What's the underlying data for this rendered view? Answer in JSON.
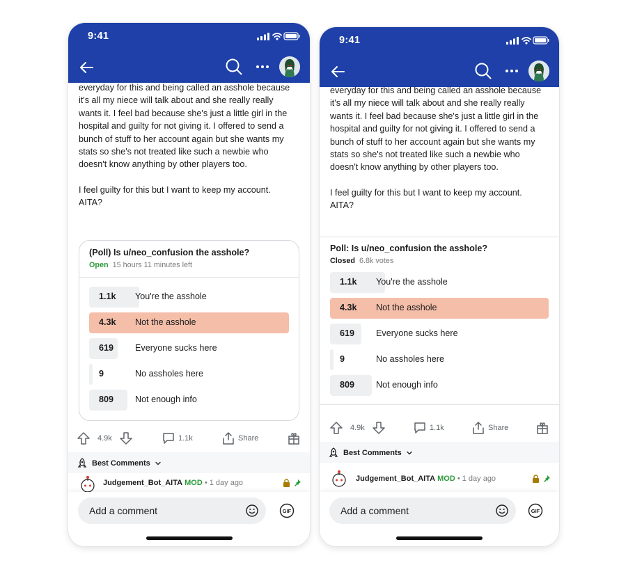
{
  "colors": {
    "header": "#1e40a8",
    "open": "#2d9b3c",
    "mod": "#2d9b3c",
    "winner_fill": "#f4bea9",
    "bar_fill": "#edeff1",
    "pin": "#2d9b3c",
    "lock": "#a67c00"
  },
  "post_body": {
    "paragraph1": "everyday for this and being called an asshole because it's all my niece will talk about and she really really wants it. I feel bad because she's just a little girl in the hospital and guilty for not giving it. I offered to send a bunch of stuff to her account again but she wants my stats so she's not treated like such a newbie who doesn't know anything by other players too.",
    "paragraph2": "I feel guilty for this but I want to keep my account. AITA?"
  },
  "left": {
    "time": "9:41",
    "poll": {
      "title": "(Poll) Is u/neo_confusion the asshole?",
      "state": "Open",
      "detail": "15 hours 11 minutes left",
      "options": [
        {
          "count": "1.1k",
          "label": "You're the asshole",
          "fraction": 0.25,
          "winner": false
        },
        {
          "count": "4.3k",
          "label": "Not the asshole",
          "fraction": 1.0,
          "winner": true
        },
        {
          "count": "619",
          "label": "Everyone sucks here",
          "fraction": 0.144,
          "winner": false
        },
        {
          "count": "9",
          "label": "No assholes here",
          "fraction": 0.01,
          "winner": false
        },
        {
          "count": "809",
          "label": "Not enough info",
          "fraction": 0.19,
          "winner": false
        }
      ]
    },
    "votes": "4.9k",
    "comments": "1.1k",
    "share": "Share",
    "sort": "Best Comments",
    "comment": {
      "author": "Judgement_Bot_AITA",
      "mod": "MOD",
      "age": "• 1 day ago"
    },
    "composer": {
      "placeholder": "Add a comment",
      "gif": "GIF"
    }
  },
  "right": {
    "time": "9:41",
    "poll": {
      "title": "Poll: Is u/neo_confusion the asshole?",
      "state": "Closed",
      "detail": "6.8k votes",
      "options": [
        {
          "count": "1.1k",
          "label": "You're the asshole",
          "fraction": 0.25,
          "winner": false
        },
        {
          "count": "4.3k",
          "label": "Not the asshole",
          "fraction": 1.0,
          "winner": true
        },
        {
          "count": "619",
          "label": "Everyone sucks here",
          "fraction": 0.144,
          "winner": false
        },
        {
          "count": "9",
          "label": "No assholes here",
          "fraction": 0.01,
          "winner": false
        },
        {
          "count": "809",
          "label": "Not enough info",
          "fraction": 0.19,
          "winner": false
        }
      ]
    },
    "votes": "4.9k",
    "comments": "1.1k",
    "share": "Share",
    "sort": "Best Comments",
    "comment": {
      "author": "Judgement_Bot_AITA",
      "mod": "MOD",
      "age": "• 1 day ago"
    },
    "composer": {
      "placeholder": "Add a comment",
      "gif": "GIF"
    }
  }
}
